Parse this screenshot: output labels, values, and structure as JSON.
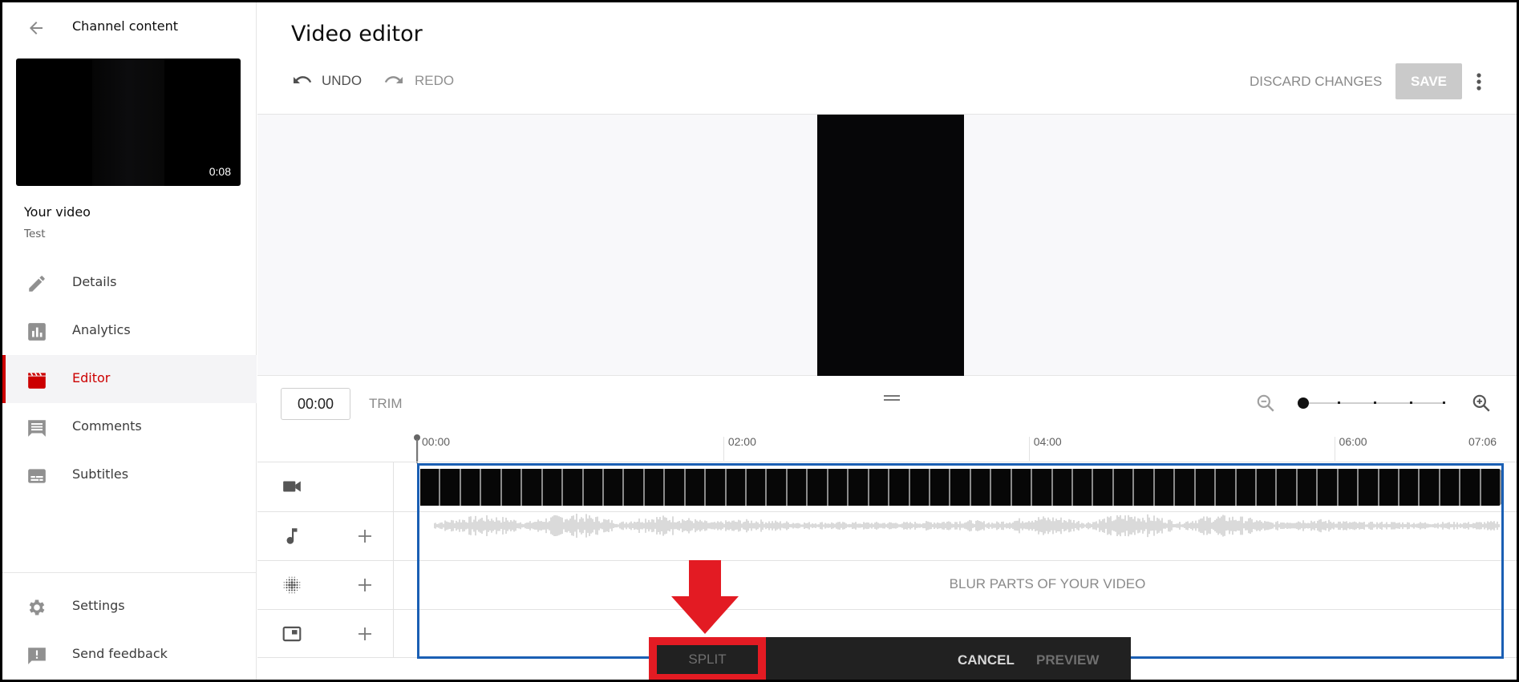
{
  "sidebar": {
    "back_label": "Channel content",
    "thumbnail_duration": "0:08",
    "your_video_label": "Your video",
    "video_title": "Test",
    "items": [
      {
        "label": "Details",
        "icon": "pencil-icon",
        "active": false
      },
      {
        "label": "Analytics",
        "icon": "analytics-icon",
        "active": false
      },
      {
        "label": "Editor",
        "icon": "clapperboard-icon",
        "active": true
      },
      {
        "label": "Comments",
        "icon": "comment-icon",
        "active": false
      },
      {
        "label": "Subtitles",
        "icon": "subtitles-icon",
        "active": false
      }
    ],
    "footer_items": [
      {
        "label": "Settings",
        "icon": "gear-icon"
      },
      {
        "label": "Send feedback",
        "icon": "feedback-icon"
      }
    ]
  },
  "header": {
    "title": "Video editor",
    "undo_label": "UNDO",
    "redo_label": "REDO",
    "discard_label": "DISCARD CHANGES",
    "save_label": "SAVE"
  },
  "controls": {
    "current_time": "00:00",
    "trim_label": "TRIM",
    "zoom_level_fraction": 0
  },
  "timeline": {
    "ticks": [
      {
        "label": "00:00",
        "seconds": 0
      },
      {
        "label": "02:00",
        "seconds": 120
      },
      {
        "label": "04:00",
        "seconds": 240
      },
      {
        "label": "06:00",
        "seconds": 360
      },
      {
        "label": "07:06",
        "seconds": 426
      }
    ],
    "duration_seconds": 426,
    "blur_label": "BLUR PARTS OF YOUR VIDEO",
    "tracks": [
      {
        "name": "video",
        "icon": "video-camera-icon",
        "has_add": false
      },
      {
        "name": "audio",
        "icon": "music-note-icon",
        "has_add": true
      },
      {
        "name": "blur",
        "icon": "blur-icon",
        "has_add": true
      },
      {
        "name": "end-screen",
        "icon": "end-screen-icon",
        "has_add": true
      }
    ]
  },
  "bottom_bar": {
    "split_label": "SPLIT",
    "cancel_label": "CANCEL",
    "preview_label": "PREVIEW"
  },
  "colors": {
    "accent_red": "#cc0000",
    "selection_blue": "#1a5fb4",
    "annotation_red": "#e31b23"
  }
}
